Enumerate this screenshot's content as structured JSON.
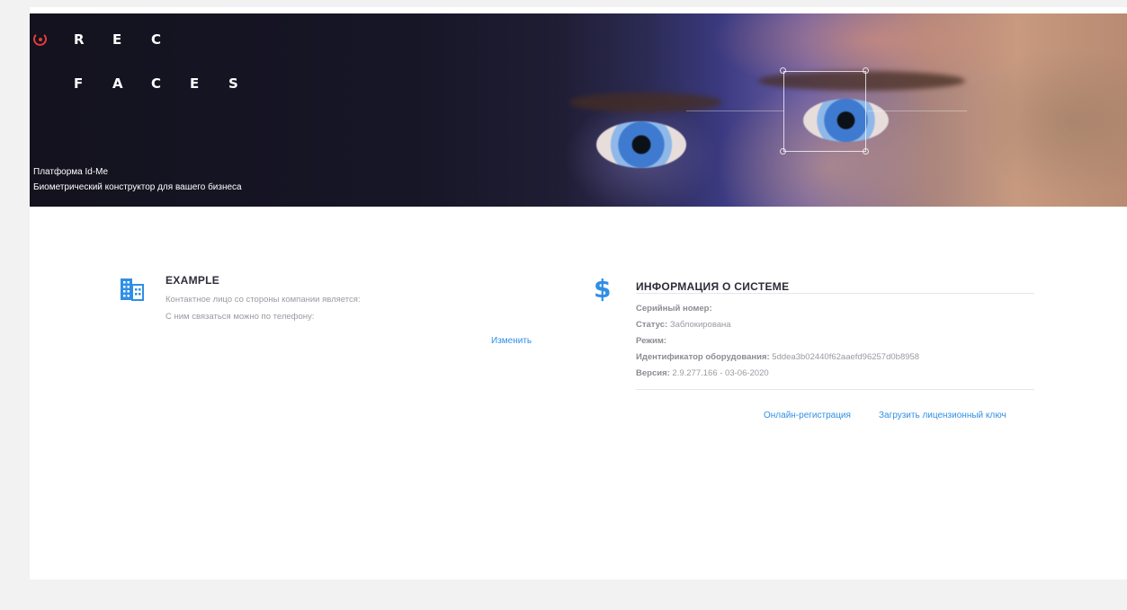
{
  "hero": {
    "logo_row1": [
      "R",
      "E",
      "C"
    ],
    "logo_row2": [
      "F",
      "A",
      "C",
      "E",
      "S"
    ],
    "tagline_line1": "Платформа Id-Me",
    "tagline_line2": "Биометрический конструктор для вашего бизнеса"
  },
  "company": {
    "title": "EXAMPLE",
    "contact_line": "Контактное лицо со стороны компании является:",
    "phone_line": "С ним связаться можно по телефону:",
    "edit_label": "Изменить"
  },
  "system": {
    "title": "ИНФОРМАЦИЯ О СИСТЕМЕ",
    "serial_label": "Серийный номер:",
    "serial_value": "",
    "status_label": "Статус:",
    "status_value": "Заблокирована",
    "mode_label": "Режим:",
    "mode_value": "",
    "hw_label": "Идентификатор оборудования:",
    "hw_value": "5ddea3b02440f62aaefd96257d0b8958",
    "version_label": "Версия:",
    "version_value": "2.9.277.166 - 03-06-2020",
    "online_reg_label": "Онлайн-регистрация",
    "upload_key_label": "Загрузить лицензионный ключ"
  },
  "colors": {
    "accent": "#2f8fe4",
    "logo_red": "#e53b3b",
    "hero_dark": "#13121e"
  },
  "icons": {
    "logo": "rec-faces-logo-icon",
    "company": "building-icon",
    "system": "dollar-icon"
  }
}
